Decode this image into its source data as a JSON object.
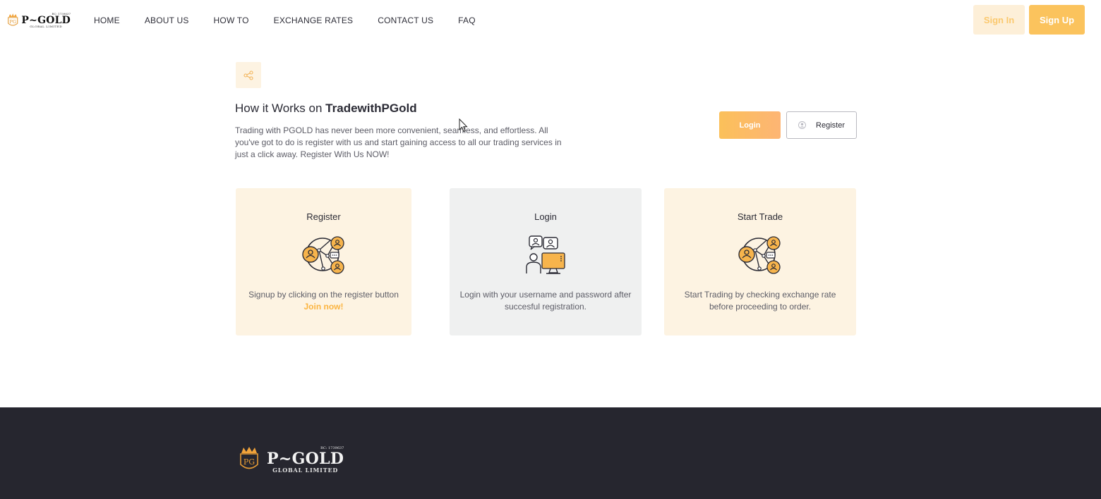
{
  "brand": {
    "rc": "RC: 1739637",
    "name": "P~GOLD",
    "sub": "GLOBAL LIMITED",
    "color": "#fbc35d",
    "logo_icon": "crown-pg-emblem-icon"
  },
  "nav": {
    "items": [
      {
        "label": "HOME"
      },
      {
        "label": "ABOUT US"
      },
      {
        "label": "HOW TO"
      },
      {
        "label": "EXCHANGE RATES"
      },
      {
        "label": "CONTACT US"
      },
      {
        "label": "FAQ"
      }
    ],
    "signin": "Sign In",
    "signup": "Sign Up"
  },
  "hero": {
    "share_icon": "share-icon",
    "title_prefix": "How it Works on ",
    "title_bold": "TradewithPGold",
    "description": "Trading with PGOLD has never been more convenient, seamless, and effortless. All you've got to do is register with us and start gaining access to all our trading services in just a click away. Register With Us NOW!",
    "login_label": "Login",
    "register_label": "Register"
  },
  "cards": [
    {
      "title": "Register",
      "icon": "network-users-icon",
      "description": "Signup by clicking on the register button ",
      "link": "Join now!"
    },
    {
      "title": "Login",
      "icon": "computer-user-login-icon",
      "description": "Login with your username and password after succesful registration."
    },
    {
      "title": "Start Trade",
      "icon": "network-users-icon",
      "description": "Start Trading by checking exchange rate before proceeding to order."
    }
  ],
  "colors": {
    "accent": "#fbc35d",
    "card_warm": "#fdf3e2",
    "card_gray": "#eff0f0",
    "footer": "#26262f"
  }
}
